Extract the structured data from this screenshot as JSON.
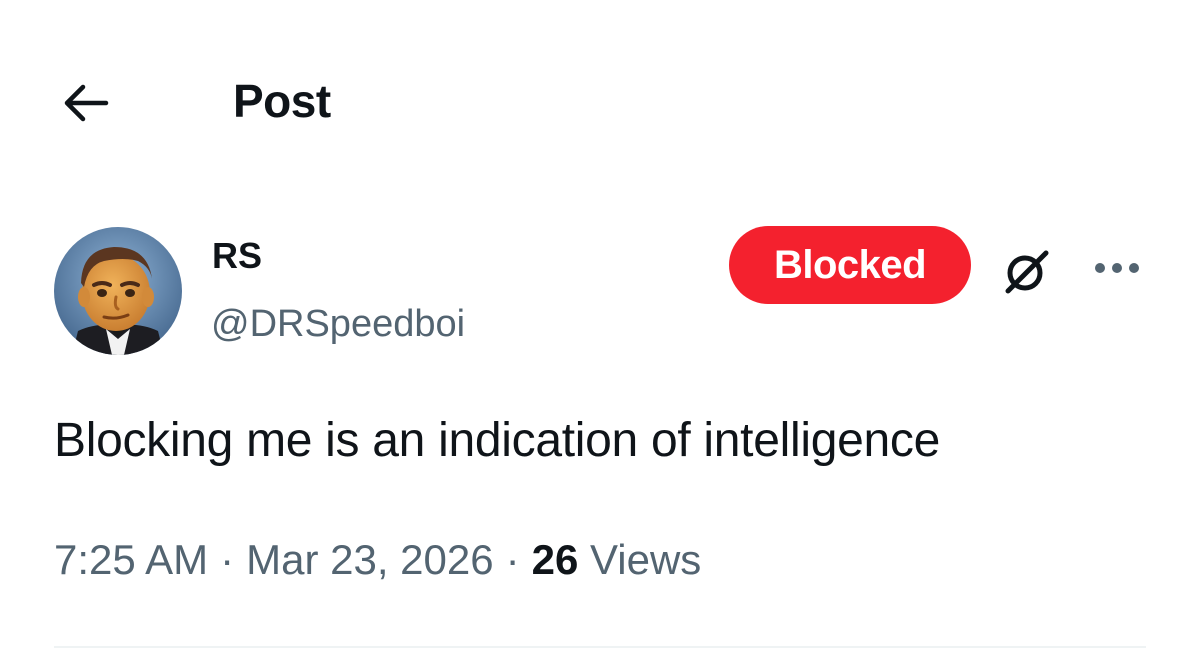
{
  "header": {
    "back_icon": "arrow-left-icon",
    "title": "Post"
  },
  "post": {
    "author": {
      "display_name": "RS",
      "handle": "@DRSpeedboi",
      "avatar_icon": "cartoon-avatar"
    },
    "blocked_label": "Blocked",
    "grok_icon": "grok-icon",
    "more_icon": "more-horizontal-icon",
    "text": "Blocking me is an indication of intelligence",
    "meta": {
      "time": "7:25 AM",
      "separator": "·",
      "date": "Mar 23, 2026",
      "views_count": "26",
      "views_label": "Views"
    }
  },
  "colors": {
    "blocked_red": "#f4212e",
    "text_primary": "#0f1419",
    "text_secondary": "#536471",
    "divider": "#eff3f4"
  }
}
